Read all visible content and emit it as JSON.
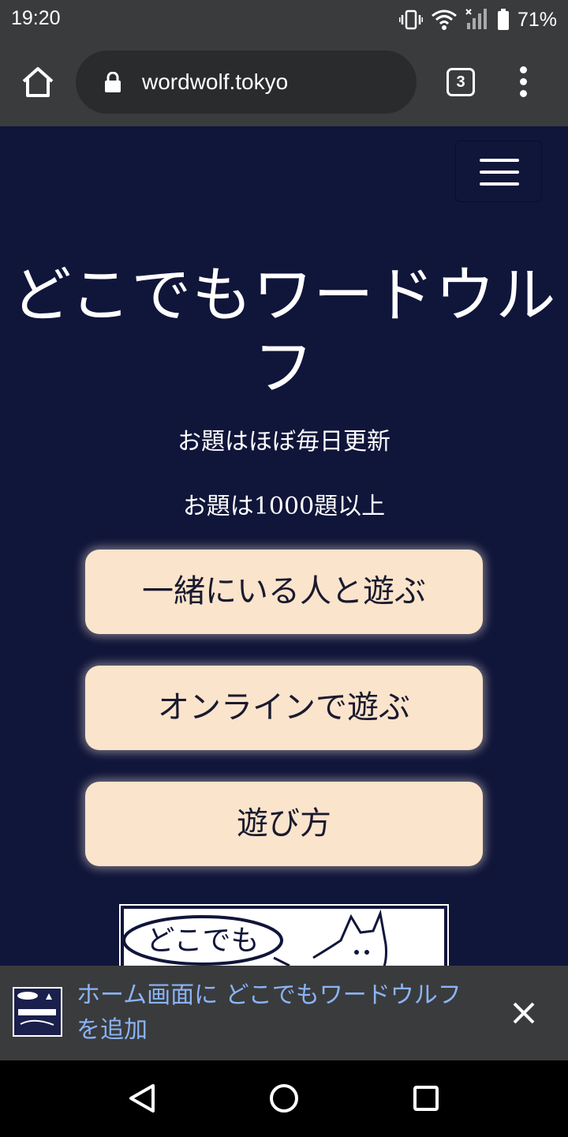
{
  "status_bar": {
    "time": "19:20",
    "battery_percent": "71%",
    "icons": [
      "vibrate-icon",
      "wifi-icon",
      "signal-icon",
      "battery-icon"
    ]
  },
  "browser": {
    "url": "wordwolf.tokyo",
    "tab_count": "3",
    "icons": [
      "home-icon",
      "lock-icon",
      "overflow-menu-icon"
    ]
  },
  "page": {
    "background_color": "#10153a",
    "title": "どこでもワードウルフ",
    "tagline_1": "お題はほぼ毎日更新",
    "tagline_2": "お題は1000題以上",
    "buttons": [
      {
        "label": "一緒にいる人と遊ぶ"
      },
      {
        "label": "オンラインで遊ぶ"
      },
      {
        "label": "遊び方"
      }
    ],
    "button_color": "#fbe4cc",
    "logo_text": "どこでも"
  },
  "banner": {
    "text": "ホーム画面に どこでもワードウルフ を追加",
    "link_color": "#8ab4f8"
  },
  "nav": {
    "icons": [
      "back-icon",
      "home-circle-icon",
      "recents-icon"
    ]
  }
}
